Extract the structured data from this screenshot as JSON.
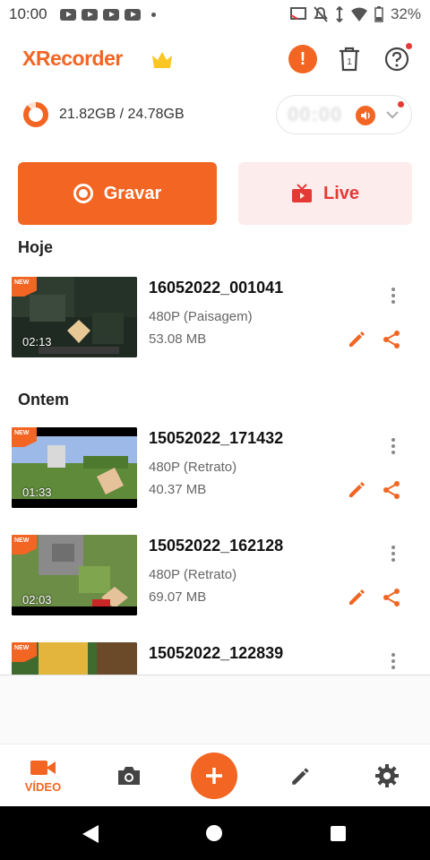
{
  "status_bar": {
    "time": "10:00",
    "battery": "32%"
  },
  "header": {
    "app_name": "XRecorder",
    "trash_count": "1"
  },
  "storage": {
    "text": "21.82GB / 24.78GB",
    "used_fraction": 0.88
  },
  "actions": {
    "record_label": "Gravar",
    "live_label": "Live"
  },
  "sections": {
    "today": "Hoje",
    "yesterday": "Ontem"
  },
  "videos": [
    {
      "badge": "NEW",
      "title": "16052022_001041",
      "resolution": "480P (Paisagem)",
      "size": "53.08 MB",
      "duration": "02:13"
    },
    {
      "badge": "NEW",
      "title": "15052022_171432",
      "resolution": "480P (Retrato)",
      "size": "40.37 MB",
      "duration": "01:33"
    },
    {
      "badge": "NEW",
      "title": "15052022_162128",
      "resolution": "480P (Retrato)",
      "size": "69.07 MB",
      "duration": "02:03"
    },
    {
      "badge": "NEW",
      "title": "15052022_122839",
      "resolution": "",
      "size": "",
      "duration": ""
    }
  ],
  "bottom_nav": {
    "video_label": "VÍDEO",
    "active": "video"
  },
  "colors": {
    "accent": "#f26522",
    "live_bg": "#fdecec",
    "live_text": "#e53935",
    "crown": "#f9c623"
  }
}
